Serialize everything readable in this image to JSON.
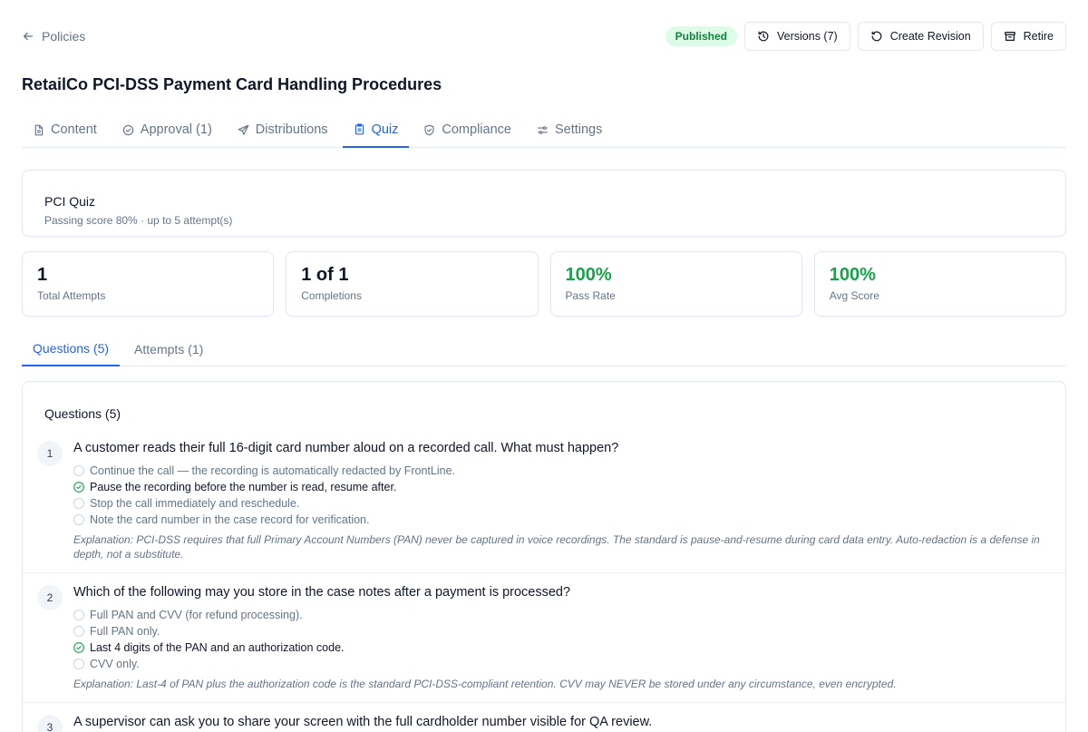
{
  "nav": {
    "back_label": "Policies"
  },
  "header": {
    "status": "Published",
    "versions_label": "Versions (7)",
    "revision_label": "Create Revision",
    "retire_label": "Retire"
  },
  "page": {
    "title": "RetailCo PCI-DSS Payment Card Handling Procedures"
  },
  "tabs": [
    {
      "label": "Content",
      "icon": "document-icon"
    },
    {
      "label": "Approval (1)",
      "icon": "check-circle-icon"
    },
    {
      "label": "Distributions",
      "icon": "send-icon"
    },
    {
      "label": "Quiz",
      "icon": "clipboard-icon",
      "active": true
    },
    {
      "label": "Compliance",
      "icon": "shield-check-icon"
    },
    {
      "label": "Settings",
      "icon": "sliders-icon"
    }
  ],
  "quiz": {
    "name": "PCI Quiz",
    "subtitle": "Passing score 80% · up to 5 attempt(s)"
  },
  "stats": [
    {
      "value": "1",
      "label": "Total Attempts"
    },
    {
      "value": "1 of 1",
      "label": "Completions"
    },
    {
      "value": "100%",
      "label": "Pass Rate",
      "color": "#16a34a"
    },
    {
      "value": "100%",
      "label": "Avg Score",
      "color": "#16a34a"
    }
  ],
  "subtabs": [
    {
      "label": "Questions (5)",
      "active": true
    },
    {
      "label": "Attempts (1)"
    }
  ],
  "questions_panel": {
    "title": "Questions (5)",
    "questions": [
      {
        "num": "1",
        "text": "A customer reads their full 16-digit card number aloud on a recorded call. What must happen?",
        "options": [
          {
            "text": "Continue the call — the recording is automatically redacted by FrontLine.",
            "correct": false
          },
          {
            "text": "Pause the recording before the number is read, resume after.",
            "correct": true
          },
          {
            "text": "Stop the call immediately and reschedule.",
            "correct": false
          },
          {
            "text": "Note the card number in the case record for verification.",
            "correct": false
          }
        ],
        "explanation": "Explanation: PCI-DSS requires that full Primary Account Numbers (PAN) never be captured in voice recordings. The standard is pause-and-resume during card data entry. Auto-redaction is a defense in depth, not a substitute."
      },
      {
        "num": "2",
        "text": "Which of the following may you store in the case notes after a payment is processed?",
        "options": [
          {
            "text": "Full PAN and CVV (for refund processing).",
            "correct": false
          },
          {
            "text": "Full PAN only.",
            "correct": false
          },
          {
            "text": "Last 4 digits of the PAN and an authorization code.",
            "correct": true
          },
          {
            "text": "CVV only.",
            "correct": false
          }
        ],
        "explanation": "Explanation: Last-4 of PAN plus the authorization code is the standard PCI-DSS-compliant retention. CVV may NEVER be stored under any circumstance, even encrypted."
      },
      {
        "num": "3",
        "text": "A supervisor can ask you to share your screen with the full cardholder number visible for QA review."
      }
    ]
  },
  "colors": {
    "accent": "#2563eb",
    "success": "#16a34a",
    "badge_bg": "#dcfce7"
  }
}
